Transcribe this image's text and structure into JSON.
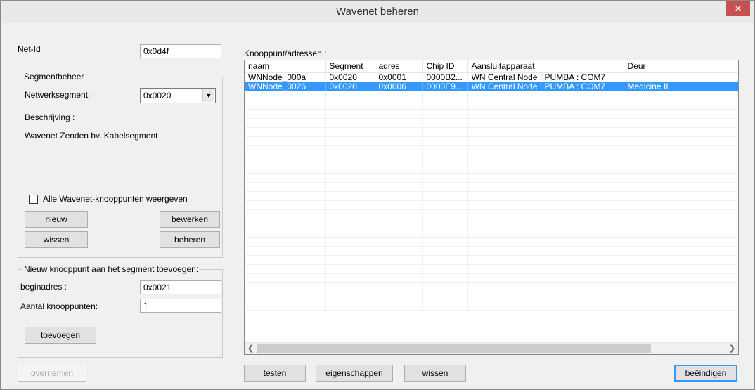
{
  "window": {
    "title": "Wavenet beheren",
    "close_glyph": "✕"
  },
  "net_id": {
    "label": "Net-Id",
    "value": "0x0d4f"
  },
  "segment_group": {
    "title": "Segmentbeheer",
    "network_segment_label": "Netwerksegment:",
    "network_segment_value": "0x0020",
    "description_label": "Beschrijving :",
    "description_text": "Wavenet Zenden bv. Kabelsegment",
    "show_all_label": "Alle Wavenet-knooppunten weergeven",
    "show_all_checked": false,
    "buttons": {
      "new": "nieuw",
      "edit": "bewerken",
      "delete": "wissen",
      "manage": "beheren"
    }
  },
  "add_group": {
    "title": "Nieuw knooppunt aan het segment toevoegen:",
    "start_address_label": "beginadres :",
    "start_address_value": "0x0021",
    "count_label": "Aantal knooppunten:",
    "count_value": "1",
    "add_button": "toevoegen"
  },
  "nodes": {
    "label": "Knooppunt/adressen :",
    "columns": [
      "naam",
      "Segment",
      "adres",
      "Chip ID",
      "Aansluitapparaat",
      "Deur"
    ],
    "rows": [
      [
        "WNNode_000a",
        "0x0020",
        "0x0001",
        "0000B2...",
        "WN Central Node : PUMBA : COM7",
        ""
      ],
      [
        "WNNode_0026",
        "0x0020",
        "0x0006",
        "0000E9...",
        "WN Central Node : PUMBA : COM7",
        "Medicine II"
      ]
    ],
    "selected_row": 1
  },
  "footer": {
    "apply": "overnemen",
    "test": "testen",
    "properties": "eigenschappen",
    "delete": "wissen",
    "finish": "beëindigen"
  },
  "colors": {
    "selection": "#3399ff",
    "close_button": "#c75050"
  },
  "icons": {
    "close": "close-icon",
    "scroll_left": "chevron-left-icon",
    "scroll_right": "chevron-right-icon",
    "dropdown": "chevron-down-icon"
  }
}
